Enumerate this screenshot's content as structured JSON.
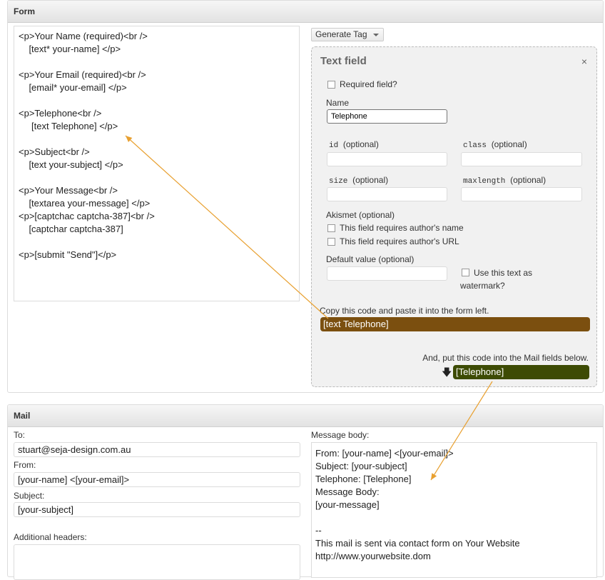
{
  "form_panel": {
    "title": "Form",
    "code_lines": [
      "<p>Your Name (required)<br />",
      "    [text* your-name] </p>",
      "",
      "<p>Your Email (required)<br />",
      "    [email* your-email] </p>",
      "",
      "<p>Telephone<br />",
      "     [text Telephone] </p>",
      "",
      "<p>Subject<br />",
      "    [text your-subject] </p>",
      "",
      "<p>Your Message<br />",
      "    [textarea your-message] </p>",
      "<p>[captchac captcha-387]<br />",
      "    [captchar captcha-387]",
      "",
      "<p>[submit \"Send\"]</p>"
    ],
    "generate_tag_label": "Generate Tag"
  },
  "tag_generator": {
    "title": "Text field",
    "close_glyph": "×",
    "required_label": "Required field?",
    "name_label": "Name",
    "name_value": "Telephone",
    "id_label": "id",
    "class_label": "class",
    "size_label": "size",
    "maxlength_label": "maxlength",
    "optional": "(optional)",
    "akismet_label": "Akismet (optional)",
    "akismet_name": "This field requires author's name",
    "akismet_url": "This field requires author's URL",
    "default_label": "Default value (optional)",
    "watermark_label_1": "Use this text as",
    "watermark_label_2": "watermark?",
    "copy_hint": "Copy this code and paste it into the form left.",
    "form_tag": "[text Telephone]",
    "mail_hint": "And, put this code into the Mail fields below.",
    "mail_tag": "[Telephone]",
    "down_arrow_glyph": "🡇"
  },
  "mail_panel": {
    "title": "Mail",
    "to_label": "To:",
    "to_value": "stuart@seja-design.com.au",
    "from_label": "From:",
    "from_value": "[your-name] <[your-email]>",
    "subject_label": "Subject:",
    "subject_value": "[your-subject]",
    "headers_label": "Additional headers:",
    "body_label": "Message body:",
    "body_lines": [
      "From: [your-name] <[your-email]>",
      "Subject: [your-subject]",
      "Telephone: [Telephone]",
      "Message Body:",
      "[your-message]",
      "",
      "--",
      "This mail is sent via contact form on Your Website",
      "http://www.yourwebsite.dom"
    ]
  },
  "colors": {
    "arrow": "#e8a030",
    "form_tag_bg": "#7b4f0f",
    "mail_tag_bg": "#3d4b04"
  }
}
